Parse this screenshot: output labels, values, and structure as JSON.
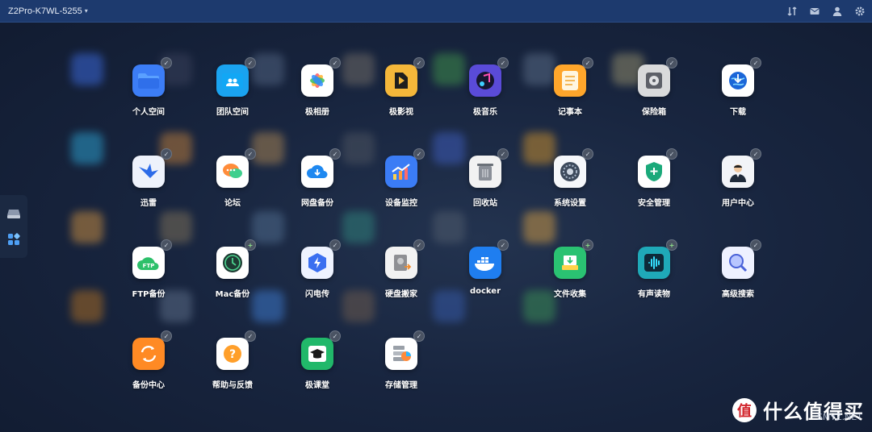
{
  "topbar": {
    "device_name": "Z2Pro-K7WL-5255",
    "icons": [
      "transfer-icon",
      "mail-icon",
      "user-icon",
      "gear-icon"
    ]
  },
  "sidedock": {
    "items": [
      "drive-icon",
      "apps-grid-icon"
    ]
  },
  "apps": [
    {
      "label": "个人空间",
      "icon": "folder-icon",
      "color": "#3c7df6",
      "badge": "check"
    },
    {
      "label": "团队空间",
      "icon": "team-folder-icon",
      "color": "#1aa3f0",
      "badge": "check"
    },
    {
      "label": "极相册",
      "icon": "photos-icon",
      "color": "#ffffff",
      "badge": "check"
    },
    {
      "label": "极影视",
      "icon": "video-icon",
      "color": "#f4b73a",
      "badge": "check"
    },
    {
      "label": "极音乐",
      "icon": "music-icon",
      "color": "#5a4bd8",
      "badge": "check"
    },
    {
      "label": "记事本",
      "icon": "notes-icon",
      "color": "#ffa62b",
      "badge": "check"
    },
    {
      "label": "保险箱",
      "icon": "safe-icon",
      "color": "#d9dadb",
      "badge": "check"
    },
    {
      "label": "下载",
      "icon": "download-globe-icon",
      "color": "#ffffff",
      "badge": "check"
    },
    {
      "label": "迅雷",
      "icon": "thunder-icon",
      "color": "#eef2fb",
      "badge": "check"
    },
    {
      "label": "论坛",
      "icon": "forum-icon",
      "color": "#ffffff",
      "badge": "check"
    },
    {
      "label": "网盘备份",
      "icon": "cloud-backup-icon",
      "color": "#ffffff",
      "badge": "check"
    },
    {
      "label": "设备监控",
      "icon": "monitor-chart-icon",
      "color": "#3b7cf5",
      "badge": "check"
    },
    {
      "label": "回收站",
      "icon": "trash-icon",
      "color": "#f2f2f2",
      "badge": "check"
    },
    {
      "label": "系统设置",
      "icon": "settings-dial-icon",
      "color": "#f5f7fa",
      "badge": "check"
    },
    {
      "label": "安全管理",
      "icon": "shield-icon",
      "color": "#ffffff",
      "badge": "check"
    },
    {
      "label": "用户中心",
      "icon": "user-center-icon",
      "color": "#f2f4f8",
      "badge": "check"
    },
    {
      "label": "FTP备份",
      "icon": "ftp-cloud-icon",
      "color": "#ffffff",
      "badge": "check"
    },
    {
      "label": "Mac备份",
      "icon": "time-machine-icon",
      "color": "#ffffff",
      "badge": "plus"
    },
    {
      "label": "闪电传",
      "icon": "flash-transfer-icon",
      "color": "#eef3ff",
      "badge": "check"
    },
    {
      "label": "硬盘搬家",
      "icon": "disk-move-icon",
      "color": "#f2f2f2",
      "badge": "check"
    },
    {
      "label": "docker",
      "icon": "docker-icon",
      "color": "#1f7ef0",
      "badge": "check"
    },
    {
      "label": "文件收集",
      "icon": "file-collect-icon",
      "color": "#2ac272",
      "badge": "plus"
    },
    {
      "label": "有声读物",
      "icon": "audiobook-icon",
      "color": "#1fa9b8",
      "badge": "plus"
    },
    {
      "label": "高级搜索",
      "icon": "advanced-search-icon",
      "color": "#eef1ff",
      "badge": "check"
    },
    {
      "label": "备份中心",
      "icon": "backup-center-icon",
      "color": "#ff8a24",
      "badge": "check"
    },
    {
      "label": "帮助与反馈",
      "icon": "help-icon",
      "color": "#ffffff",
      "badge": "check"
    },
    {
      "label": "极课堂",
      "icon": "classroom-icon",
      "color": "#21b86a",
      "badge": "check"
    },
    {
      "label": "存储管理",
      "icon": "storage-icon",
      "color": "#ffffff",
      "badge": "check"
    }
  ],
  "watermark": {
    "brand": "什么值得买",
    "site": "SMYZ.NET"
  }
}
